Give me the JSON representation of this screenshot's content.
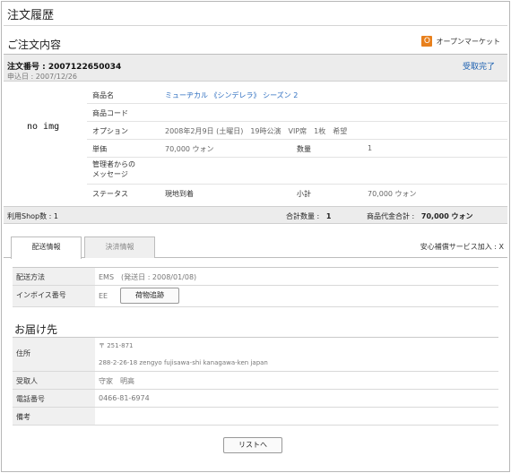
{
  "page": {
    "title": "注文履歴",
    "section_title": "ご注文内容"
  },
  "open_market": {
    "badge": "O",
    "label": "オープンマーケット",
    "badge_color": "#e8801c"
  },
  "order": {
    "number_label": "注文番号 :",
    "number": "2007122650034",
    "date_label": "申込日 :",
    "date": "2007/12/26",
    "status": "受取完了"
  },
  "item": {
    "no_image": "no img",
    "rows": {
      "product_name": {
        "label": "商品名",
        "value": "ミューヂカル 《シンデレラ》 シーズン 2"
      },
      "product_code": {
        "label": "商品コード",
        "value": ""
      },
      "option": {
        "label": "オプション",
        "value": "2008年2月9日 (土曜日)　19時公演　VIP席　1枚　希望"
      },
      "price": {
        "label": "単価",
        "value": "70,000 ウォン",
        "qty_label": "数量",
        "qty_value": "1"
      },
      "admin_message": {
        "label_line1": "管理者からの",
        "label_line2": "メッセージ",
        "value": ""
      },
      "status": {
        "label": "ステータス",
        "value": "現地到着",
        "subtotal_label": "小計",
        "subtotal_value": "70,000 ウォン"
      }
    }
  },
  "summary": {
    "shop_count": "利用Shop数 : 1",
    "total_qty_label": "合計数量 :",
    "total_qty": "1",
    "total_amount_label": "商品代金合計 :",
    "total_amount": "70,000 ウォン"
  },
  "tabs": [
    {
      "label": "配送情報",
      "active": true
    },
    {
      "label": "決済情報",
      "active": false
    }
  ],
  "insurance": "安心補償サービス加入 : X",
  "shipping": {
    "method_label": "配送方法",
    "method_value": "EMS　(発送日 : 2008/01/08)",
    "invoice_label": "インボイス番号",
    "invoice_value": "EE",
    "track_button": "荷物追跡"
  },
  "delivery": {
    "title": "お届け先",
    "address_label": "住所",
    "address_line1": "〒 251-871",
    "address_line2": "288-2-26-18 zengyo fujisawa-shi kanagawa-ken japan",
    "recipient_label": "受取人",
    "recipient_value": "守家　明高",
    "phone_label": "電話番号",
    "phone_value": "0466-81-6974",
    "note_label": "備考",
    "note_value": ""
  },
  "list_button": "リストへ"
}
